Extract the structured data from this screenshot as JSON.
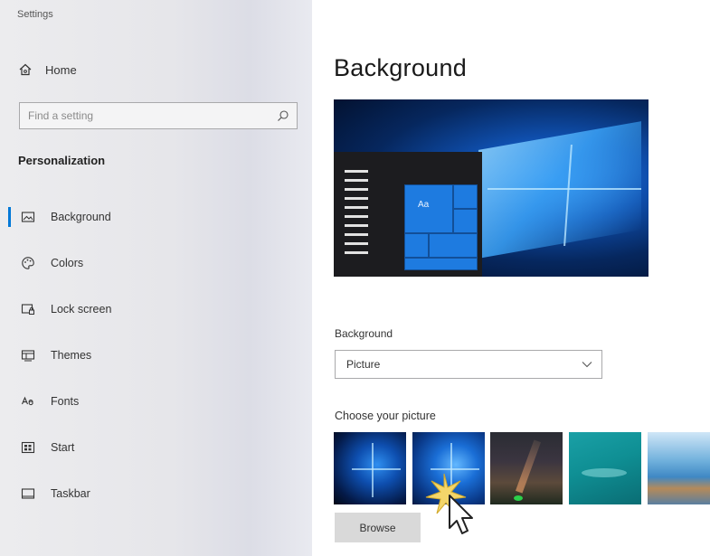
{
  "app": {
    "title": "Settings"
  },
  "sidebar": {
    "home_label": "Home",
    "search_placeholder": "Find a setting",
    "section_title": "Personalization",
    "items": [
      {
        "label": "Background",
        "icon": "picture-icon",
        "active": true
      },
      {
        "label": "Colors",
        "icon": "palette-icon",
        "active": false
      },
      {
        "label": "Lock screen",
        "icon": "lock-screen-icon",
        "active": false
      },
      {
        "label": "Themes",
        "icon": "themes-icon",
        "active": false
      },
      {
        "label": "Fonts",
        "icon": "fonts-icon",
        "active": false
      },
      {
        "label": "Start",
        "icon": "start-icon",
        "active": false
      },
      {
        "label": "Taskbar",
        "icon": "taskbar-icon",
        "active": false
      }
    ]
  },
  "main": {
    "title": "Background",
    "preview_tile_text": "Aa",
    "background_label": "Background",
    "background_value": "Picture",
    "choose_label": "Choose your picture",
    "browse_label": "Browse"
  },
  "colors": {
    "accent": "#0078d7",
    "sidebar_bg": "#e6e6ea",
    "button_bg": "#d9d9d9"
  }
}
